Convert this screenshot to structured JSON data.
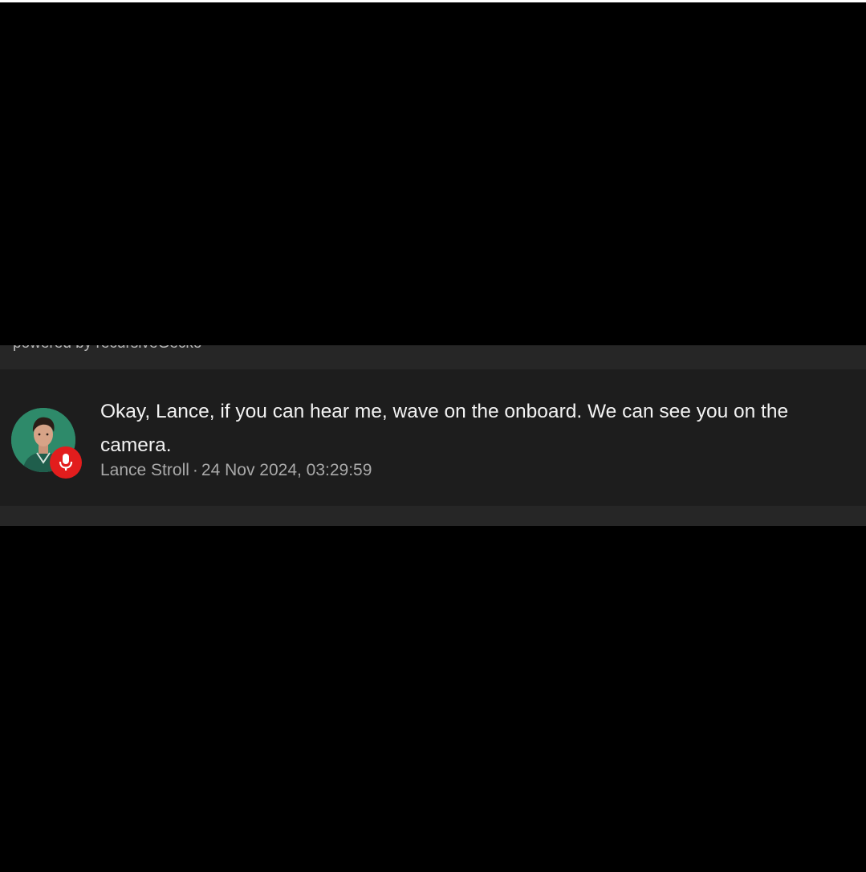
{
  "footer": {
    "powered_by": "powered by recursiveGecko"
  },
  "message": {
    "text": "Okay, Lance, if you can hear me, wave on the onboard. We can see you on the camera.",
    "author": "Lance Stroll",
    "separator": "·",
    "timestamp": "24 Nov 2024, 03:29:59",
    "avatar_icon": "driver-photo",
    "badge_icon": "microphone-icon"
  },
  "colors": {
    "avatar_bg": "#2e8a6a",
    "badge_bg": "#e21d1d",
    "panel_bg": "#262626",
    "card_bg": "#1d1d1d"
  }
}
